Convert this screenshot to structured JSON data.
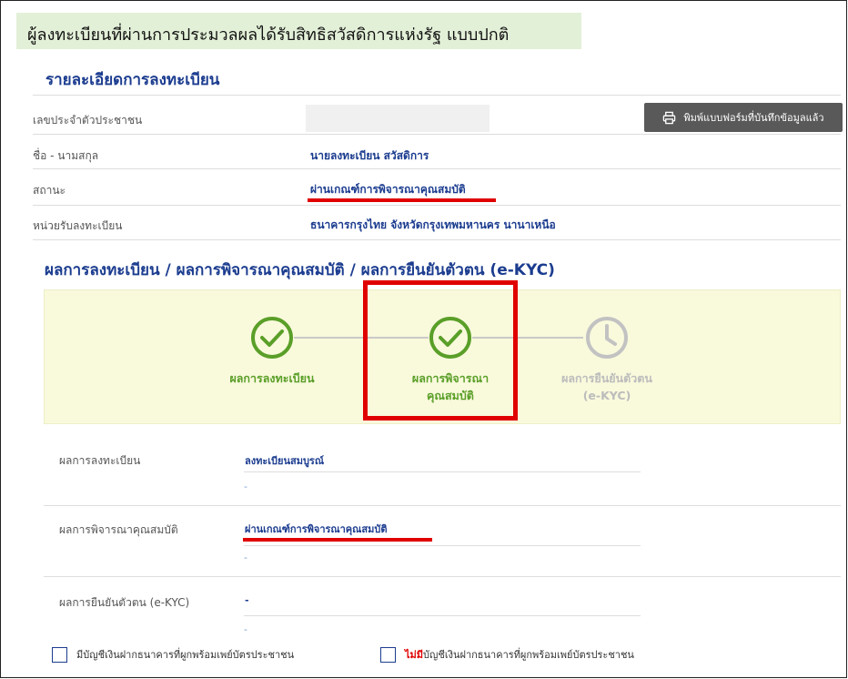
{
  "banner": {
    "text": "ผู้ลงทะเบียนที่ผ่านการประมวลผลได้รับสิทธิสวัสดิการแห่งรัฐ แบบปกติ"
  },
  "registration": {
    "title": "รายละเอียดการลงทะเบียน",
    "id_label": "เลขประจำตัวประชาชน",
    "print_button": "พิมพ์แบบฟอร์มที่บันทึกข้อมูลแล้ว",
    "rows": [
      {
        "label": "ชื่อ - นามสกุล",
        "value": "นายลงทะเบียน สวัสดิการ"
      },
      {
        "label": "สถานะ",
        "value": "ผ่านเกณฑ์การพิจารณาคุณสมบัติ"
      },
      {
        "label": "หน่วยรับลงทะเบียน",
        "value": "ธนาคารกรุงไทย จังหวัดกรุงเทพมหานคร นานาเหนือ"
      }
    ]
  },
  "results": {
    "title": "ผลการลงทะเบียน / ผลการพิจารณาคุณสมบัติ / ผลการยืนยันตัวตน (e-KYC)",
    "steps": [
      {
        "line1": "ผลการลงทะเบียน",
        "line2": "",
        "status": "done",
        "icon": "check-circle-icon"
      },
      {
        "line1": "ผลการพิจารณา",
        "line2": "คุณสมบัติ",
        "status": "done",
        "icon": "check-circle-icon"
      },
      {
        "line1": "ผลการยืนยันตัวตน",
        "line2": "(e-KYC)",
        "status": "pending",
        "icon": "clock-icon"
      }
    ],
    "rows": [
      {
        "label": "ผลการลงทะเบียน",
        "value": "ลงทะเบียนสมบูรณ์",
        "sub": "-"
      },
      {
        "label": "ผลการพิจารณาคุณสมบัติ",
        "value": "ผ่านเกณฑ์การพิจารณาคุณสมบัติ",
        "sub": "-"
      },
      {
        "label": "ผลการยืนยันตัวตน (e-KYC)",
        "value": "-",
        "sub": "-"
      }
    ]
  },
  "checkboxes": {
    "option1": "มีบัญชีเงินฝากธนาคารที่ผูกพร้อมเพย์บัตรประชาชน",
    "option2_prefix": "ไม่มี",
    "option2_rest": "บัญชีเงินฝากธนาคารที่ผูกพร้อมเพย์บัตรประชาชน"
  },
  "colors": {
    "accent": "#1b3c8f",
    "success": "#5a9f28",
    "highlight": "#e00000",
    "banner": "#e3f0d8",
    "panel": "#f9f9dc"
  }
}
